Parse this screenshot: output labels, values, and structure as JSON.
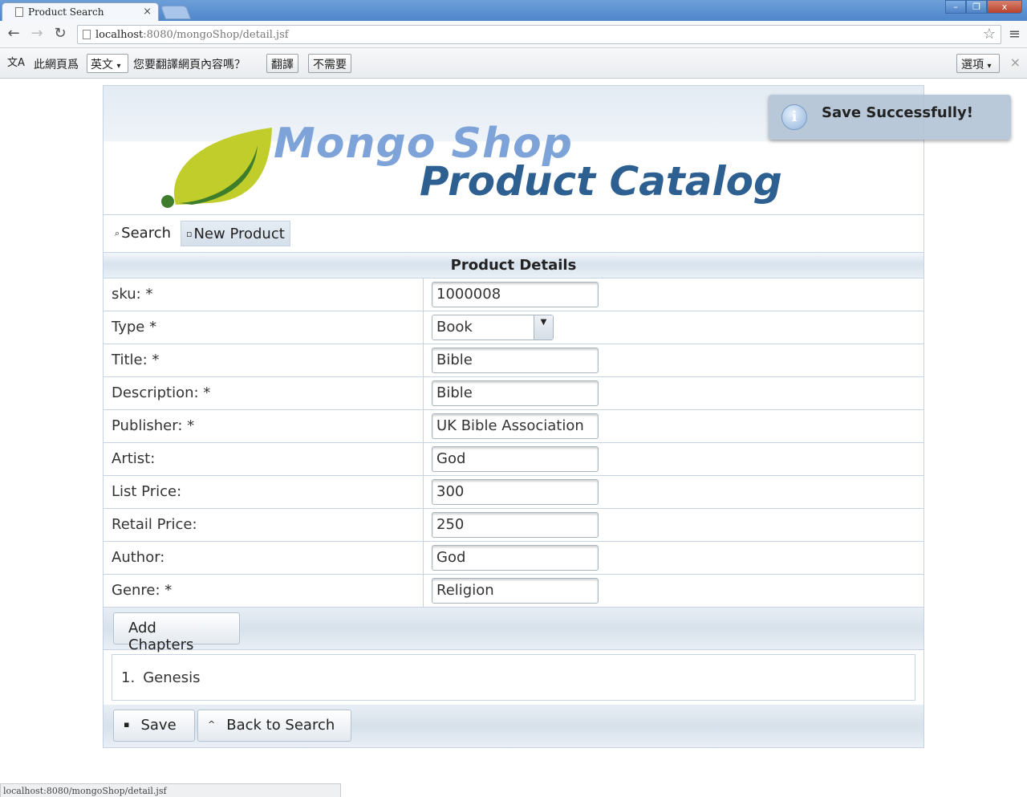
{
  "browser": {
    "tab_title": "Product Search",
    "tab_close": "×",
    "url_host": "localhost",
    "url_rest": ":8080/mongoShop/detail.jsf",
    "win_minimize": "–",
    "win_restore": "❐",
    "win_close": "x",
    "back_icon": "←",
    "forward_icon": "→",
    "reload_icon": "↻",
    "star_icon": "☆",
    "menu_icon": "≡"
  },
  "translate_bar": {
    "icon": "文A",
    "text1": "此網頁爲",
    "language": "英文",
    "text2": "您要翻譯網頁內容嗎？",
    "translate_button": "翻譯",
    "no_button": "不需要",
    "options_button": "選項",
    "close": "×"
  },
  "header": {
    "logo_line1": "Mongo Shop",
    "logo_line2": "Product Catalog",
    "leaf_colors": [
      "#c0cd2b",
      "#3e7d2b"
    ]
  },
  "menu": {
    "search_label": "Search",
    "search_icon": "⌕",
    "new_product_label": "New Product",
    "new_product_icon": "▫"
  },
  "panel": {
    "title": "Product Details",
    "fields": [
      {
        "label": "sku: *",
        "value": "1000008"
      },
      {
        "label": "Type *",
        "value": "Book",
        "kind": "select"
      },
      {
        "label": "Title: *",
        "value": "Bible"
      },
      {
        "label": "Description: *",
        "value": "Bible"
      },
      {
        "label": "Publisher: *",
        "value": "UK Bible Association"
      },
      {
        "label": "Artist:",
        "value": "God"
      },
      {
        "label": "List Price:",
        "value": "300"
      },
      {
        "label": "Retail Price:",
        "value": "250"
      },
      {
        "label": "Author:",
        "value": "God"
      },
      {
        "label": "Genre: *",
        "value": "Religion"
      }
    ],
    "add_chapters_label": "Add Chapters",
    "chapters": [
      {
        "num": "1.",
        "title": "Genesis"
      }
    ],
    "save_label": "Save",
    "save_icon": "▪",
    "back_label": "Back to Search",
    "back_icon": "^"
  },
  "growl": {
    "icon": "i",
    "message": "Save Successfully!"
  },
  "status_bar": "localhost:8080/mongoShop/detail.jsf",
  "colors": {
    "accent_blue": "#2d6090",
    "logo_light_blue": "#7ea3d9",
    "border": "#c5d3e2"
  }
}
